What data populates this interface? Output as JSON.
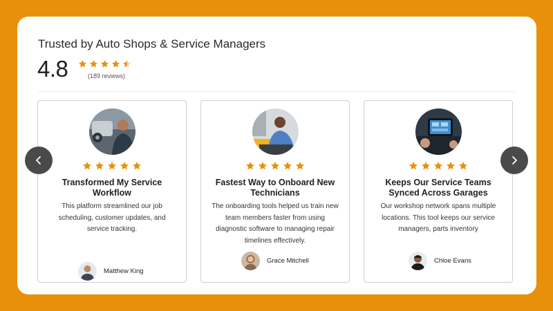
{
  "header": {
    "title": "Trusted by Auto Shops & Service Managers",
    "rating": "4.8",
    "rating_stars": 4.5,
    "reviews": "(189 reviews)"
  },
  "carousel": {
    "prev_icon": "chevron-left-icon",
    "next_icon": "chevron-right-icon"
  },
  "testimonials": [
    {
      "stars": 5,
      "title": "Transformed My Service Workflow",
      "text": "This platform streamlined our job scheduling, customer updates, and service tracking.",
      "author": "Matthew King"
    },
    {
      "stars": 5,
      "title": "Fastest Way to Onboard New Technicians",
      "text": "The onboarding tools helped us train new team members faster from using diagnostic software to managing repair timelines effectively.",
      "author": "Grace Mitchell"
    },
    {
      "stars": 5,
      "title": "Keeps Our Service Teams Synced Across Garages",
      "text": "Our workshop network spans multiple locations. This tool keeps our service managers, parts inventory",
      "author": "Chloe Evans"
    }
  ],
  "colors": {
    "background": "#E8900A",
    "star": "#E8900A",
    "nav_button": "#4a4a4a"
  }
}
